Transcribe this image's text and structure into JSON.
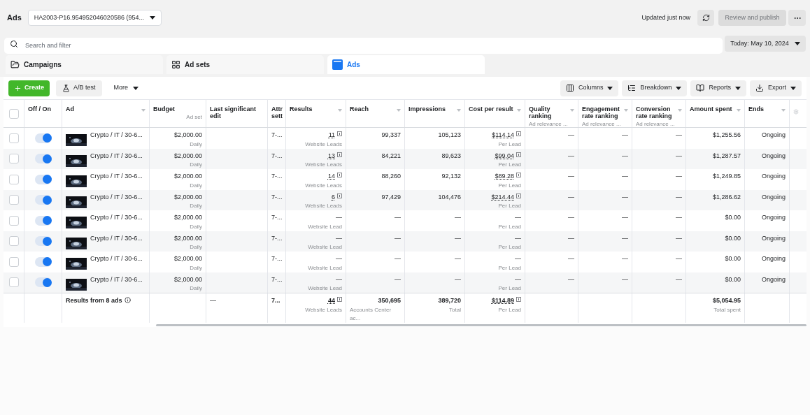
{
  "header": {
    "title": "Ads",
    "account": "HA2003-P16.954952046020586 (954...",
    "status": "Updated just now",
    "publish": {
      "label": "Review and publish",
      "disabled": true
    }
  },
  "search": {
    "placeholder": "Search and filter"
  },
  "date": "Today: May 10, 2024",
  "tabs": [
    {
      "label": "Campaigns",
      "kind": "folder",
      "selected": false
    },
    {
      "label": "Ad sets",
      "kind": "grid",
      "selected": false
    },
    {
      "label": "Ads",
      "kind": "ad",
      "selected": true
    }
  ],
  "toolbar": {
    "create": "Create",
    "ab_test": "A/B test",
    "more": "More",
    "right": [
      {
        "label": "Columns",
        "kind": "columns"
      },
      {
        "label": "Breakdown",
        "kind": "breakdown"
      },
      {
        "label": "Reports",
        "kind": "reports"
      },
      {
        "label": "Export",
        "kind": "export"
      }
    ]
  },
  "table": {
    "select_all": {
      "checked": false
    },
    "columns": [
      {
        "label": "Off / On",
        "sort": false
      },
      {
        "label": "Ad",
        "sort": true
      },
      {
        "label": "Budget",
        "sub": "Ad set",
        "sort": false
      },
      {
        "label": "Last significant edit",
        "sort": false
      },
      {
        "label": "Attr sett",
        "sort": false
      },
      {
        "label": "Results",
        "sort": true
      },
      {
        "label": "Reach",
        "sort": true
      },
      {
        "label": "Impressions",
        "sort": true
      },
      {
        "label": "Cost per result",
        "sort": true
      },
      {
        "label": "Quality ranking",
        "sub": "Ad relevance ...",
        "sort": true
      },
      {
        "label": "Engagement rate ranking",
        "sub": "Ad relevance ...",
        "sort": true
      },
      {
        "label": "Conversion rate ranking",
        "sub": "Ad relevance ...",
        "sort": true
      },
      {
        "label": "Amount spent",
        "sort": true
      },
      {
        "label": "Ends",
        "sort": true
      }
    ],
    "rows": [
      {
        "checked": false,
        "on": true,
        "ad": "Crypto / IT / 30-6...",
        "budget": "$2,000.00",
        "budget_sub": "Daily",
        "attr": "7-...",
        "results": {
          "text": "11",
          "sub": "Website Leads",
          "linked": true
        },
        "reach": "99,337",
        "impressions": "105,123",
        "cost": {
          "text": "$114.14",
          "sub": "Per Lead",
          "linked": true
        },
        "quality": "—",
        "engagement": "—",
        "conversion": "—",
        "amount": "$1,255.56",
        "ends": "Ongoing"
      },
      {
        "checked": false,
        "on": true,
        "ad": "Crypto / IT / 30-6...",
        "budget": "$2,000.00",
        "budget_sub": "Daily",
        "attr": "7-...",
        "results": {
          "text": "13",
          "sub": "Website Leads",
          "linked": true
        },
        "reach": "84,221",
        "impressions": "89,623",
        "cost": {
          "text": "$99.04",
          "sub": "Per Lead",
          "linked": true
        },
        "quality": "—",
        "engagement": "—",
        "conversion": "—",
        "amount": "$1,287.57",
        "ends": "Ongoing"
      },
      {
        "checked": false,
        "on": true,
        "ad": "Crypto / IT / 30-6...",
        "budget": "$2,000.00",
        "budget_sub": "Daily",
        "attr": "7-...",
        "results": {
          "text": "14",
          "sub": "Website Leads",
          "linked": true
        },
        "reach": "88,260",
        "impressions": "92,132",
        "cost": {
          "text": "$89.28",
          "sub": "Per Lead",
          "linked": true
        },
        "quality": "—",
        "engagement": "—",
        "conversion": "—",
        "amount": "$1,249.85",
        "ends": "Ongoing"
      },
      {
        "checked": false,
        "on": true,
        "ad": "Crypto / IT / 30-6...",
        "budget": "$2,000.00",
        "budget_sub": "Daily",
        "attr": "7-...",
        "results": {
          "text": "6",
          "sub": "Website Leads",
          "linked": true
        },
        "reach": "97,429",
        "impressions": "104,476",
        "cost": {
          "text": "$214.44",
          "sub": "Per Lead",
          "linked": true
        },
        "quality": "—",
        "engagement": "—",
        "conversion": "—",
        "amount": "$1,286.62",
        "ends": "Ongoing"
      },
      {
        "checked": false,
        "on": true,
        "ad": "Crypto / IT / 30-6...",
        "budget": "$2,000.00",
        "budget_sub": "Daily",
        "attr": "7-...",
        "results": {
          "text": "—",
          "sub": "Website Lead",
          "linked": false
        },
        "reach": "—",
        "impressions": "—",
        "cost": {
          "text": "—",
          "sub": "Per Lead",
          "linked": false
        },
        "quality": "—",
        "engagement": "—",
        "conversion": "—",
        "amount": "$0.00",
        "ends": "Ongoing"
      },
      {
        "checked": false,
        "on": true,
        "ad": "Crypto / IT / 30-6...",
        "budget": "$2,000.00",
        "budget_sub": "Daily",
        "attr": "7-...",
        "results": {
          "text": "—",
          "sub": "Website Lead",
          "linked": false
        },
        "reach": "—",
        "impressions": "—",
        "cost": {
          "text": "—",
          "sub": "Per Lead",
          "linked": false
        },
        "quality": "—",
        "engagement": "—",
        "conversion": "—",
        "amount": "$0.00",
        "ends": "Ongoing"
      },
      {
        "checked": false,
        "on": true,
        "ad": "Crypto / IT / 30-6...",
        "budget": "$2,000.00",
        "budget_sub": "Daily",
        "attr": "7-...",
        "results": {
          "text": "—",
          "sub": "Website Lead",
          "linked": false
        },
        "reach": "—",
        "impressions": "—",
        "cost": {
          "text": "—",
          "sub": "Per Lead",
          "linked": false
        },
        "quality": "—",
        "engagement": "—",
        "conversion": "—",
        "amount": "$0.00",
        "ends": "Ongoing"
      },
      {
        "checked": false,
        "on": true,
        "ad": "Crypto / IT / 30-6...",
        "budget": "$2,000.00",
        "budget_sub": "Daily",
        "attr": "7-...",
        "results": {
          "text": "—",
          "sub": "Website Lead",
          "linked": false
        },
        "reach": "—",
        "impressions": "—",
        "cost": {
          "text": "—",
          "sub": "Per Lead",
          "linked": false
        },
        "quality": "—",
        "engagement": "—",
        "conversion": "—",
        "amount": "$0.00",
        "ends": "Ongoing"
      }
    ],
    "totals": {
      "label": "Results from 8 ads",
      "edit": "—",
      "attr": "7...",
      "results": {
        "text": "44",
        "sub": "Website Leads",
        "linked": true
      },
      "reach": {
        "text": "350,695",
        "sub": "Accounts Center ac..."
      },
      "impressions": {
        "text": "389,720",
        "sub": "Total"
      },
      "cost": {
        "text": "$114.89",
        "sub": "Per Lead",
        "linked": true
      },
      "amount": {
        "text": "$5,054.95",
        "sub": "Total spent"
      }
    }
  }
}
